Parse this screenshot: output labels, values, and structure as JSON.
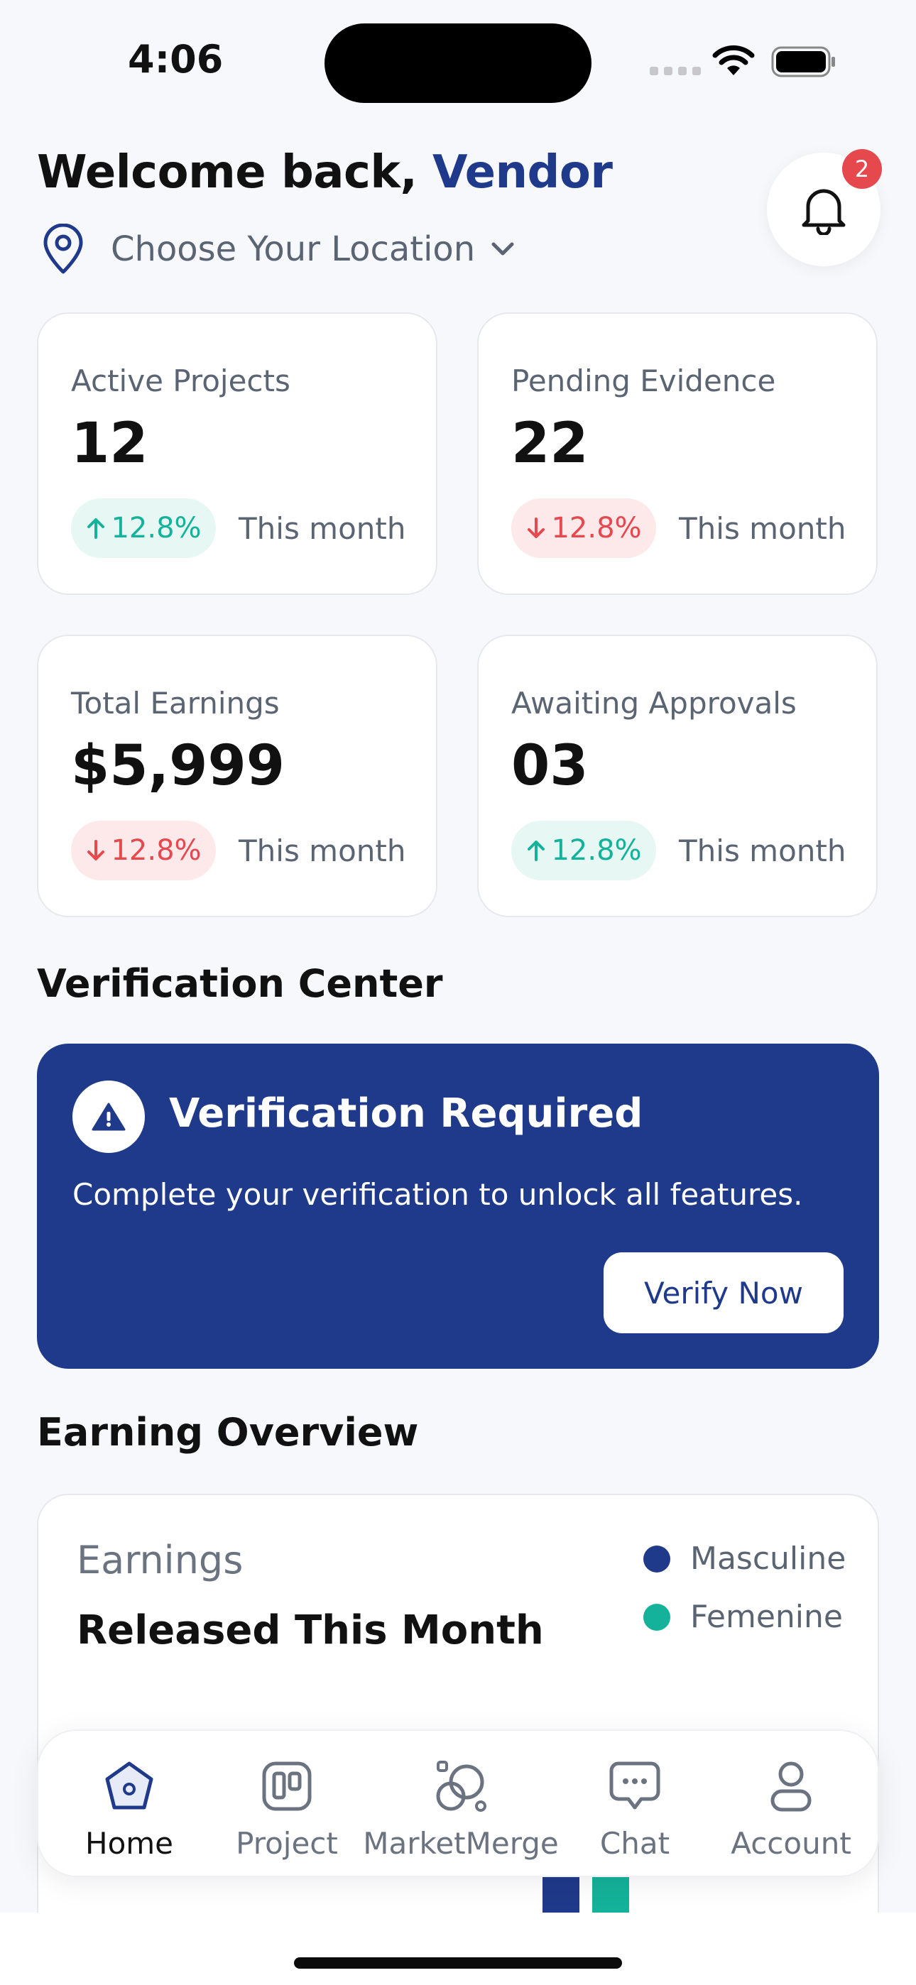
{
  "status_bar": {
    "time": "4:06"
  },
  "header": {
    "welcome_prefix": "Welcome back, ",
    "user_name": "Vendor",
    "location_label": "Choose Your Location",
    "notification_count": "2"
  },
  "stats": [
    {
      "label": "Active Projects",
      "value": "12",
      "change": "12.8%",
      "direction": "up",
      "period": "This month"
    },
    {
      "label": "Pending Evidence",
      "value": "22",
      "change": "12.8%",
      "direction": "down",
      "period": "This month"
    },
    {
      "label": "Total Earnings",
      "value": "$5,999",
      "change": "12.8%",
      "direction": "down",
      "period": "This month"
    },
    {
      "label": "Awaiting Approvals",
      "value": "03",
      "change": "12.8%",
      "direction": "up",
      "period": "This month"
    }
  ],
  "verification": {
    "section_title": "Verification Center",
    "title": "Verification Required",
    "description": "Complete your verification to unlock all features.",
    "button_label": "Verify Now"
  },
  "earnings": {
    "section_title": "Earning Overview",
    "subtitle": "Earnings",
    "title": "Released This Month",
    "legend": [
      {
        "name": "Masculine",
        "color": "#1f3a8a"
      },
      {
        "name": "Femenine",
        "color": "#14b29a"
      }
    ]
  },
  "nav": [
    {
      "label": "Home",
      "icon": "home-icon",
      "active": true
    },
    {
      "label": "Project",
      "icon": "board-icon",
      "active": false
    },
    {
      "label": "MarketMerge",
      "icon": "marketmerge-icon",
      "active": false
    },
    {
      "label": "Chat",
      "icon": "chat-icon",
      "active": false
    },
    {
      "label": "Account",
      "icon": "user-icon",
      "active": false
    }
  ],
  "colors": {
    "primary": "#1f3a8a",
    "up": "#14b29a",
    "down": "#e5484d"
  }
}
